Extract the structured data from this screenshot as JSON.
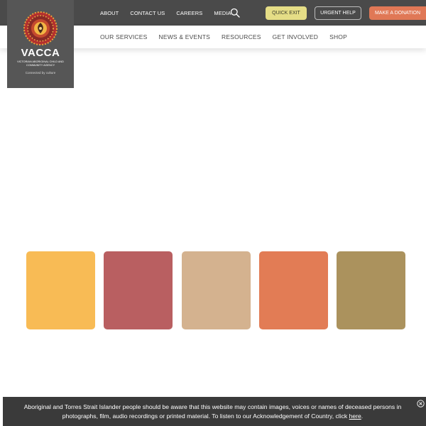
{
  "topbar": {
    "links": [
      {
        "label": "About"
      },
      {
        "label": "Contact Us"
      },
      {
        "label": "Careers"
      },
      {
        "label": "Media"
      }
    ],
    "search_icon": "search-icon",
    "quick_exit_label": "Quick Exit",
    "urgent_help_label": "Urgent Help",
    "donate_label": "Make a Donation"
  },
  "nav": {
    "items": [
      {
        "label": "Our Services"
      },
      {
        "label": "News & Events"
      },
      {
        "label": "Resources"
      },
      {
        "label": "Get Involved"
      },
      {
        "label": "Shop"
      }
    ]
  },
  "logo": {
    "name": "VACCA",
    "subtitle": "Victorian Aboriginal Child and Community Agency",
    "tagline": "Connected by culture"
  },
  "swatches": [
    {
      "color": "#f8bb55"
    },
    {
      "color": "#b95f61"
    },
    {
      "color": "#d4b28f"
    },
    {
      "color": "#e27c55"
    },
    {
      "color": "#ab925d"
    }
  ],
  "colors": {
    "topbar": "#4a4a4a",
    "logo_bg": "#565656",
    "quick_exit": "#e5dd86",
    "donate": "#e07856",
    "banner": "#3a3a3a"
  },
  "acknowledgement": {
    "text": "Aboriginal and Torres Strait Islander people should be aware that this website may contain images, voices or names of deceased persons in photographs, film, audio recordings or printed material. To listen to our Acknowledgement of Country, click ",
    "link_label": "here",
    "end": ".",
    "close_icon": "close-icon"
  }
}
